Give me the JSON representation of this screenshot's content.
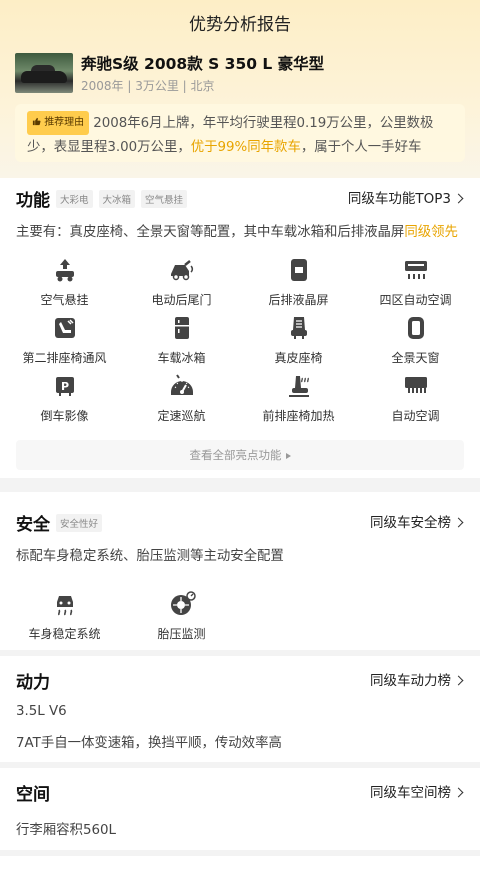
{
  "page": {
    "title": "优势分析报告"
  },
  "car": {
    "name": "奔驰S级 2008款 S 350 L 豪华型",
    "meta": "2008年 | 3万公里 | 北京"
  },
  "reason": {
    "tag": "推荐理由",
    "text_before": "2008年6月上牌，年平均行驶里程0.19万公里，公里数极少，表显里程3.00万公里，",
    "highlight": "优于99%同年款车",
    "text_after": "，属于个人一手好车"
  },
  "features": {
    "title": "功能",
    "tags": [
      "大彩电",
      "大冰箱",
      "空气悬挂"
    ],
    "link": "同级车功能TOP3",
    "desc_before": "主要有：真皮座椅、全景天窗等配置，其中车载冰箱和后排液晶屏",
    "desc_highlight": "同级领先",
    "items": [
      {
        "label": "空气悬挂",
        "icon": "air-suspension-icon"
      },
      {
        "label": "电动后尾门",
        "icon": "power-tailgate-icon"
      },
      {
        "label": "后排液晶屏",
        "icon": "rear-screen-icon"
      },
      {
        "label": "四区自动空调",
        "icon": "four-zone-ac-icon"
      },
      {
        "label": "第二排座椅通风",
        "icon": "seat-ventilation-icon"
      },
      {
        "label": "车载冰箱",
        "icon": "fridge-icon"
      },
      {
        "label": "真皮座椅",
        "icon": "leather-seat-icon"
      },
      {
        "label": "全景天窗",
        "icon": "panoramic-sunroof-icon"
      },
      {
        "label": "倒车影像",
        "icon": "reverse-camera-icon"
      },
      {
        "label": "定速巡航",
        "icon": "cruise-control-icon"
      },
      {
        "label": "前排座椅加热",
        "icon": "seat-heating-icon"
      },
      {
        "label": "自动空调",
        "icon": "auto-ac-icon"
      }
    ],
    "see_all": "查看全部亮点功能"
  },
  "safety": {
    "title": "安全",
    "tag": "安全性好",
    "link": "同级车安全榜",
    "desc": "标配车身稳定系统、胎压监测等主动安全配置",
    "items": [
      {
        "label": "车身稳定系统",
        "icon": "stability-control-icon"
      },
      {
        "label": "胎压监测",
        "icon": "tire-pressure-icon"
      }
    ]
  },
  "power": {
    "title": "动力",
    "link": "同级车动力榜",
    "engine": "3.5L V6",
    "gearbox": "7AT手自一体变速箱，换挡平顺，传动效率高"
  },
  "space": {
    "title": "空间",
    "link": "同级车空间榜",
    "trunk": "行李厢容积560L"
  },
  "colors": {
    "accent": "#e8a400",
    "tag_yellow": "#ffcc4d",
    "header_bg": "#fdeec6"
  }
}
